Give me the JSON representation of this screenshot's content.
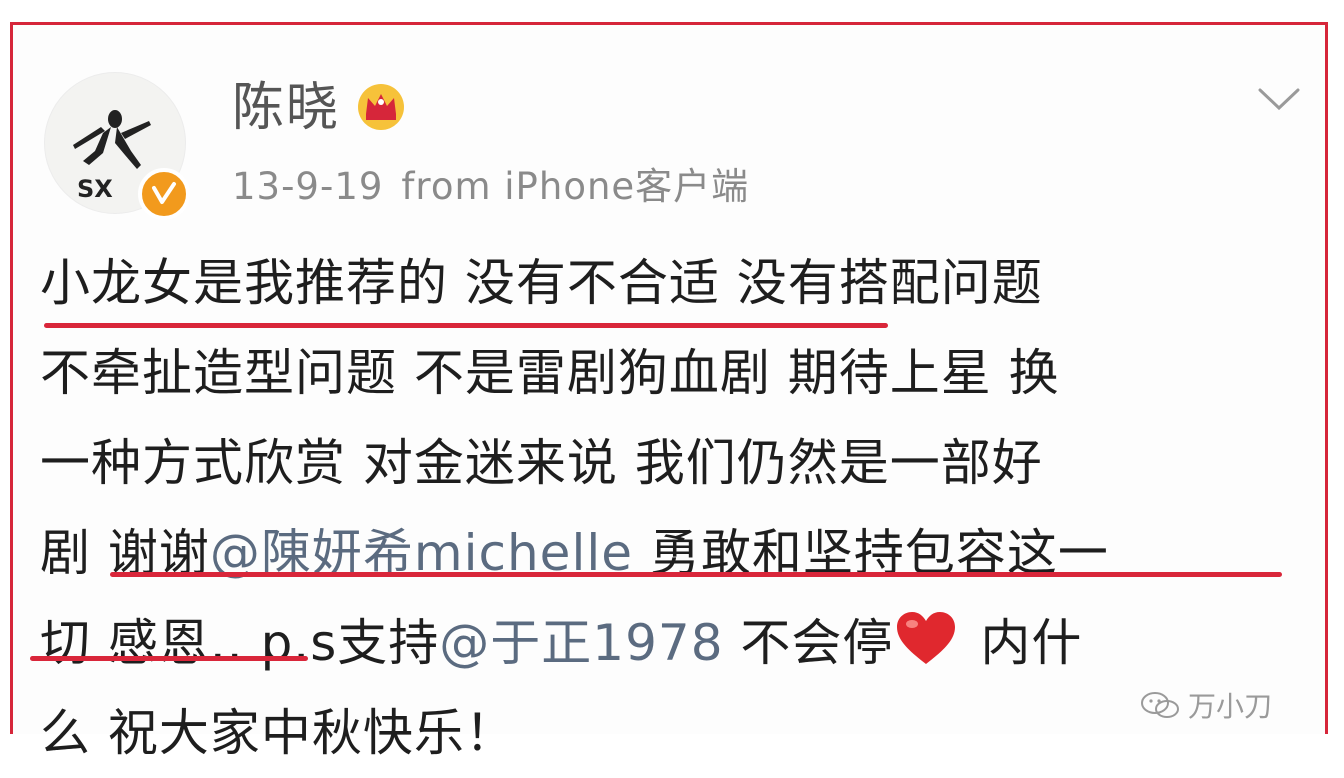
{
  "header": {
    "username": "陈晓",
    "date": "13-9-19",
    "source": "from iPhone客户端",
    "avatar_text": "SX"
  },
  "post": {
    "lines": [
      [
        {
          "text": "小龙女是我推荐的 没有不合适 ",
          "type": "text"
        },
        {
          "text": "没有搭配问题",
          "type": "text"
        }
      ],
      [
        {
          "text": "不牵扯造型问题 不是雷剧狗血剧 期待上星 换",
          "type": "text"
        }
      ],
      [
        {
          "text": "一种方式欣赏 对金迷来说 我们仍然是一部好",
          "type": "text"
        }
      ],
      [
        {
          "text": "剧 谢谢",
          "type": "text"
        },
        {
          "text": "@陳妍希michelle",
          "type": "mention"
        },
        {
          "text": " 勇敢和坚持包容这一",
          "type": "text"
        }
      ],
      [
        {
          "text": "切 感恩.. p.s支持",
          "type": "text"
        },
        {
          "text": "@于正1978",
          "type": "mention"
        },
        {
          "text": " 不会停",
          "type": "text"
        },
        {
          "text": "❤",
          "type": "heart"
        },
        {
          "text": " 内什",
          "type": "text"
        }
      ],
      [
        {
          "text": "么 祝大家中秋快乐！",
          "type": "text"
        }
      ]
    ]
  },
  "watermark": {
    "text": "万小刀",
    "icon": "wechat-icon"
  },
  "icons": {
    "crown": "crown-icon",
    "verified": "verified-badge-icon",
    "menu": "chevron-down-icon"
  },
  "colors": {
    "highlight_border": "#d6263a",
    "underline": "#d9263a",
    "mention": "#5b6b80",
    "verified": "#f29a1d"
  }
}
